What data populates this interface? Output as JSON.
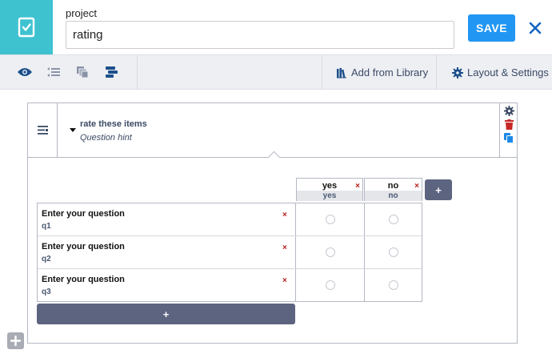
{
  "header": {
    "project_label": "project",
    "title_value": "rating",
    "save_label": "SAVE",
    "close_icon": "close-icon",
    "logo_icon": "form-check-icon"
  },
  "toolbar": {
    "icons": [
      "eye-icon",
      "list-toggle-icon",
      "layers-icon",
      "logic-icon"
    ],
    "add_from_library": "Add from Library",
    "layout_settings": "Layout & Settings"
  },
  "question": {
    "title": "rate these items",
    "hint": "Question hint",
    "columns": [
      {
        "label": "yes",
        "value": "yes"
      },
      {
        "label": "no",
        "value": "no"
      }
    ],
    "rows": [
      {
        "label": "Enter your question",
        "value": "q1"
      },
      {
        "label": "Enter your question",
        "value": "q2"
      },
      {
        "label": "Enter your question",
        "value": "q3"
      }
    ],
    "add_column_label": "+",
    "add_row_label": "+",
    "delete_glyph": "×"
  },
  "colors": {
    "accent": "#2196f3",
    "logo_bg": "#3fc2d0",
    "toolbar_bg": "#edeff3",
    "button_dark": "#5c6480",
    "delete_red": "#b71c1c",
    "copy_blue": "#1e88e5"
  }
}
